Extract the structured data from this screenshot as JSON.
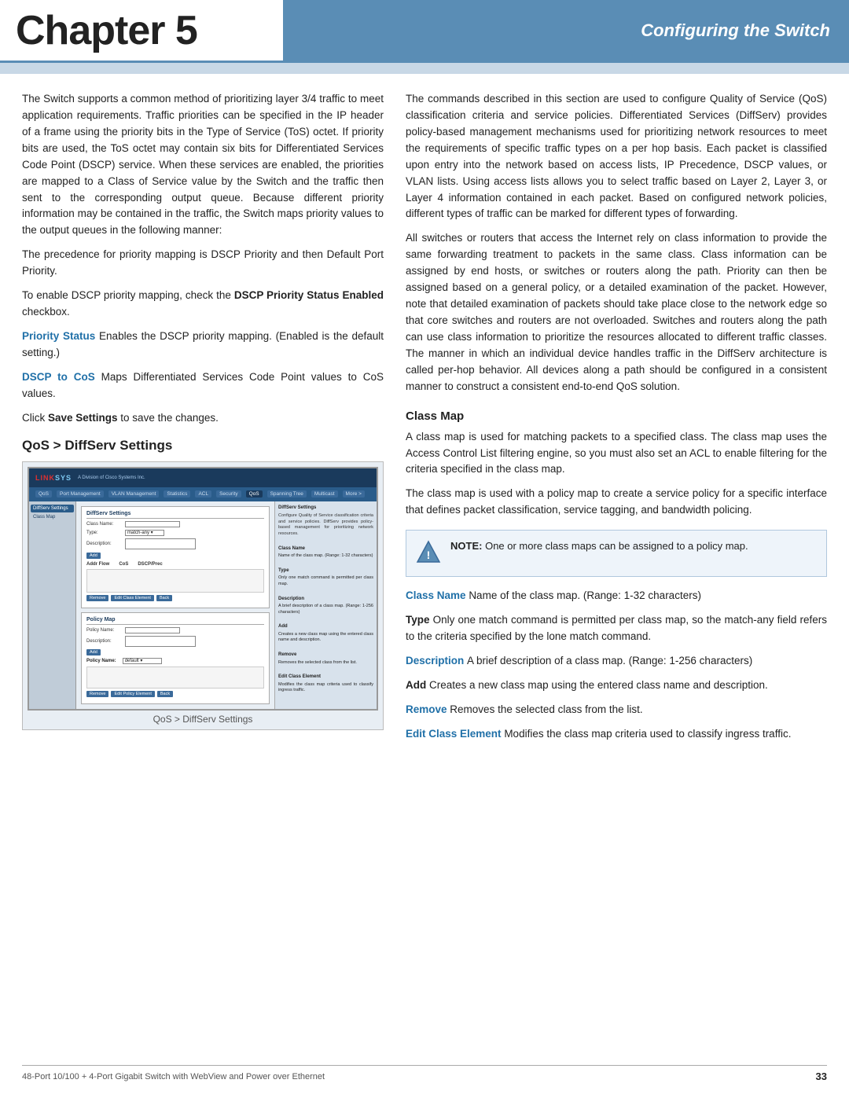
{
  "header": {
    "chapter": "Chapter 5",
    "section": "Configuring the Switch"
  },
  "footer": {
    "left": "48-Port 10/100 + 4-Port Gigabit Switch with WebView and Power over Ethernet",
    "page": "33"
  },
  "content": {
    "left_col": {
      "para1": "The Switch supports a common method of prioritizing layer 3/4 traffic to meet application requirements. Traffic priorities can be specified in the IP header of a frame using the priority bits in the Type of Service (ToS) octet. If priority bits are used, the ToS octet may contain six bits for Differentiated Services Code Point (DSCP) service. When these services are enabled, the priorities are mapped to a Class of Service value by the Switch and the traffic then sent to the corresponding output queue. Because different priority information may be contained in the traffic, the Switch maps priority values to the output queues in the following manner:",
      "para2": "The precedence for priority mapping is DSCP Priority and then Default Port Priority.",
      "para3_prefix": "To enable DSCP priority mapping, check the ",
      "para3_bold": "DSCP Priority Status Enabled",
      "para3_suffix": " checkbox.",
      "priority_status_label": "Priority Status",
      "priority_status_text": "Enables the DSCP priority mapping. (Enabled is the default setting.)",
      "dscp_cos_label": "DSCP to CoS",
      "dscp_cos_text": "Maps Differentiated Services Code Point values to CoS values.",
      "save_text_prefix": "Click ",
      "save_text_bold": "Save Settings",
      "save_text_suffix": " to save the changes.",
      "section_heading": "QoS > DiffServ Settings",
      "screenshot_caption": "QoS > DiffServ Settings"
    },
    "right_col": {
      "intro_para": "The commands described in this section are used to configure Quality of Service (QoS) classification criteria and service policies. Differentiated Services (DiffServ) provides policy-based management mechanisms used for prioritizing network resources to meet the requirements of specific traffic types on a per hop basis. Each packet is classified upon entry into the network based on access lists, IP Precedence, DSCP values, or VLAN lists. Using access lists allows you to select traffic based on Layer 2, Layer 3, or Layer 4 information contained in each packet. Based on configured network policies, different types of traffic can be marked for different types of forwarding.",
      "para2": "All switches or routers that access the Internet rely on class information to provide the same forwarding treatment to packets in the same class. Class information can be assigned by end hosts, or switches or routers along the path. Priority can then be assigned based on a general policy, or a detailed examination of the packet. However, note that detailed examination of packets should take place close to the network edge so that core switches and routers are not overloaded. Switches and routers along the path can use class information to prioritize the resources allocated to different traffic classes. The manner in which an individual device handles traffic in the DiffServ architecture is called per-hop behavior. All devices along a path should be configured in a consistent manner to construct a consistent end-to-end QoS solution.",
      "class_map_heading": "Class Map",
      "class_map_para1": "A class map is used for matching packets to a specified class. The class map uses the Access Control List filtering engine, so you must also set an ACL to enable filtering for the criteria specified in the class map.",
      "class_map_para2": "The class map is used with a policy map to create a service policy for a specific interface that defines packet classification, service tagging, and bandwidth policing.",
      "note_label": "NOTE:",
      "note_text": "One or more class maps can be assigned to a policy map.",
      "class_name_label": "Class Name",
      "class_name_text": "Name of the class map. (Range: 1-32 characters)",
      "type_label": "Type",
      "type_text": "Only one match command is permitted per class map, so the match-any field refers to the criteria specified by the lone match command.",
      "description_label": "Description",
      "description_text": "A brief description of a class map. (Range: 1-256 characters)",
      "add_label": "Add",
      "add_text": "Creates a new class map using the entered class name and description.",
      "remove_label": "Remove",
      "remove_text": "Removes the selected class from the list.",
      "edit_class_label": "Edit Class Element",
      "edit_class_text": "Modifies the class map criteria used to classify ingress traffic."
    }
  },
  "fake_ui": {
    "logo": "LINKSYS",
    "nav_items": [
      "QoS",
      "Port Management",
      "VLAN Management",
      "Statistics",
      "ACL",
      "Security",
      "QoS",
      "Spanning Tree",
      "Multicast",
      "More >"
    ],
    "sidebar_items": [
      "DiffServ Settings",
      "Class Map"
    ],
    "panel1_title": "DiffServ Settings",
    "panel2_title": "Policy Map",
    "fields": {
      "class_name": "Class Name",
      "type": "Type",
      "description": "Description",
      "policy_name": "Policy Name",
      "description2": "Description"
    },
    "buttons": [
      "Add",
      "Remove",
      "Edit"
    ]
  }
}
